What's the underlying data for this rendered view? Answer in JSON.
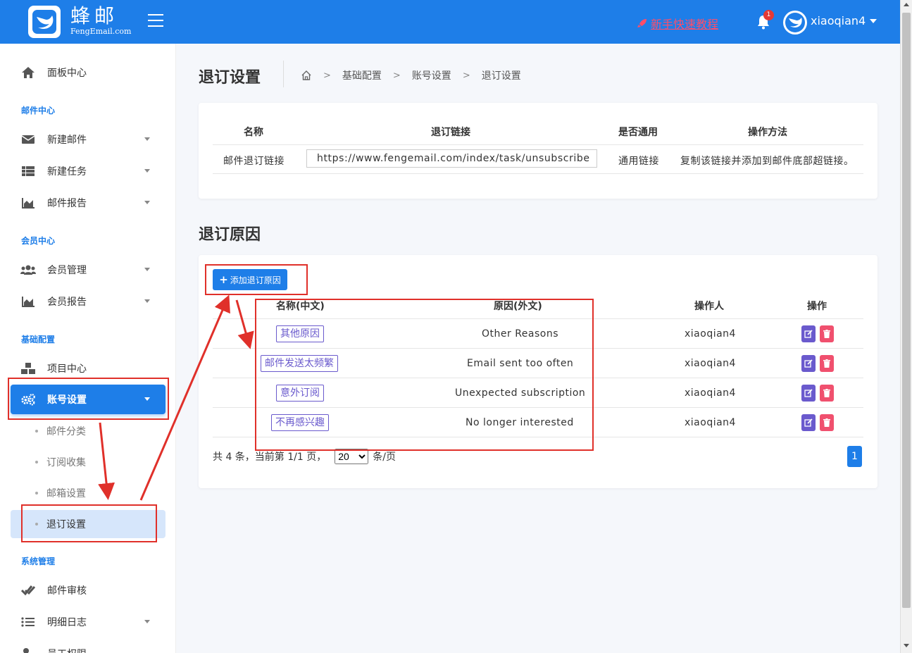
{
  "header": {
    "brand_cn": "蜂邮",
    "brand_en": "FengEmail.com",
    "tutorial_link": "新手快速教程",
    "notification_count": "1",
    "username": "xiaoqian4"
  },
  "sidebar": {
    "dashboard": "面板中心",
    "sections": {
      "mail_center": "邮件中心",
      "member_center": "会员中心",
      "basic_config": "基础配置",
      "system_mgmt": "系统管理"
    },
    "items": {
      "new_mail": "新建邮件",
      "new_task": "新建任务",
      "mail_report": "邮件报告",
      "member_mgmt": "会员管理",
      "member_report": "会员报告",
      "project_center": "项目中心",
      "account_settings": "账号设置",
      "mail_review": "邮件审核",
      "detail_log": "明细日志",
      "staff_permissions": "员工权限"
    },
    "sub_items": {
      "mail_category": "邮件分类",
      "subscription_collect": "订阅收集",
      "mailbox_settings": "邮箱设置",
      "unsubscribe_settings": "退订设置"
    }
  },
  "page": {
    "title": "退订设置",
    "breadcrumb": [
      "基础配置",
      "账号设置",
      "退订设置"
    ]
  },
  "link_table": {
    "headers": [
      "名称",
      "退订链接",
      "是否通用",
      "操作方法"
    ],
    "row": {
      "name": "邮件退订链接",
      "url": "https://www.fengemail.com/index/task/unsubscribe",
      "general": "通用链接",
      "method": "复制该链接并添加到邮件底部超链接。"
    }
  },
  "reasons": {
    "section_title": "退订原因",
    "add_button": "添加退订原因",
    "headers": [
      "名称(中文)",
      "原因(外文)",
      "操作人",
      "操作"
    ],
    "rows": [
      {
        "cn": "其他原因",
        "en": "Other Reasons",
        "operator": "xiaoqian4"
      },
      {
        "cn": "邮件发送太频繁",
        "en": "Email sent too often",
        "operator": "xiaoqian4"
      },
      {
        "cn": "意外订阅",
        "en": "Unexpected subscription",
        "operator": "xiaoqian4"
      },
      {
        "cn": "不再感兴趣",
        "en": "No longer interested",
        "operator": "xiaoqian4"
      }
    ],
    "pager": {
      "summary": "共 4 条，当前第 1/1 页，",
      "page_size": "20",
      "per_page_suffix": "条/页",
      "current_page": "1"
    }
  },
  "colors": {
    "primary": "#1e7ee8",
    "tag": "#6a5acd",
    "delete": "#f0506e",
    "annotation": "#e0302a"
  }
}
